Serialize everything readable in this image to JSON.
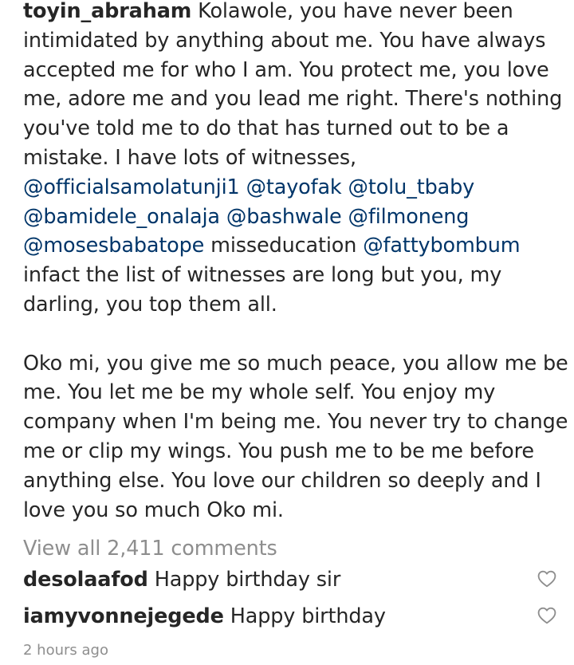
{
  "caption": {
    "username": "toyin_abraham",
    "line1_text": " Kolawole, you have never been",
    "line2": "intimidated by anything about me. You have always",
    "line3": "accepted me for who I am. You protect me, you love",
    "line4": "me, adore me and you lead me right. There's nothing",
    "line5": "you've told me to do that has turned out to be a",
    "line6": "mistake. I have lots of witnesses,",
    "mentions": {
      "m1": "@officialsamolatunji1",
      "m2": "@tayofak",
      "m3": "@tolu_tbaby",
      "m4": "@bamidele_onalaja",
      "m5": "@bashwale",
      "m6": "@filmoneng",
      "m7": "@mosesbabatope",
      "m8": "@fattybombum"
    },
    "misseducation": " misseducation ",
    "line11": "infact the list of witnesses are long but you, my",
    "line12": "darling, you top them all.",
    "p2_line1": "Oko mi, you give me so much peace, you allow me be",
    "p2_line2": "me. You let me be my whole self. You enjoy my",
    "p2_line3": "company when I'm being me. You never try to change",
    "p2_line4": "me or clip my wings. You push me to be me before",
    "p2_line5": "anything else. You love our children so deeply and I",
    "p2_line6": "love you so much Oko mi."
  },
  "view_all_comments": "View all 2,411 comments",
  "comments": [
    {
      "username": "desolaafod",
      "text": " Happy birthday sir"
    },
    {
      "username": "iamyvonnejegede",
      "text": " Happy birthday"
    }
  ],
  "timestamp": "2 hours ago",
  "icons": {
    "like": "heart-outline-icon"
  },
  "colors": {
    "text": "#262626",
    "mention": "#003569",
    "muted": "#8e8e8e"
  }
}
